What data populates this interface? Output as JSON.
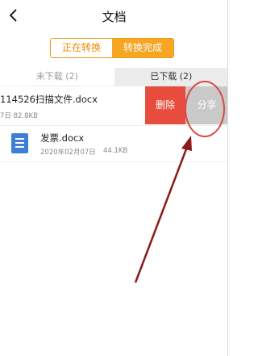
{
  "header": {
    "title": "文档"
  },
  "segment": {
    "converting_label": "正在转换",
    "done_label": "转换完成"
  },
  "tabs": {
    "not_downloaded": "未下载 (2)",
    "downloaded": "已下载 (2)"
  },
  "files": [
    {
      "name": "114526扫描文件.docx",
      "meta": "7日   82.8KB"
    },
    {
      "name": "发票.docx",
      "date": "2020年02月07日",
      "size": "44.1KB"
    }
  ],
  "actions": {
    "delete_label": "删除",
    "share_label": "分享"
  },
  "colors": {
    "accent": "#f5a623",
    "delete": "#e84c3d",
    "share": "#c9c9c9",
    "annotation": "#8b1a1a"
  }
}
